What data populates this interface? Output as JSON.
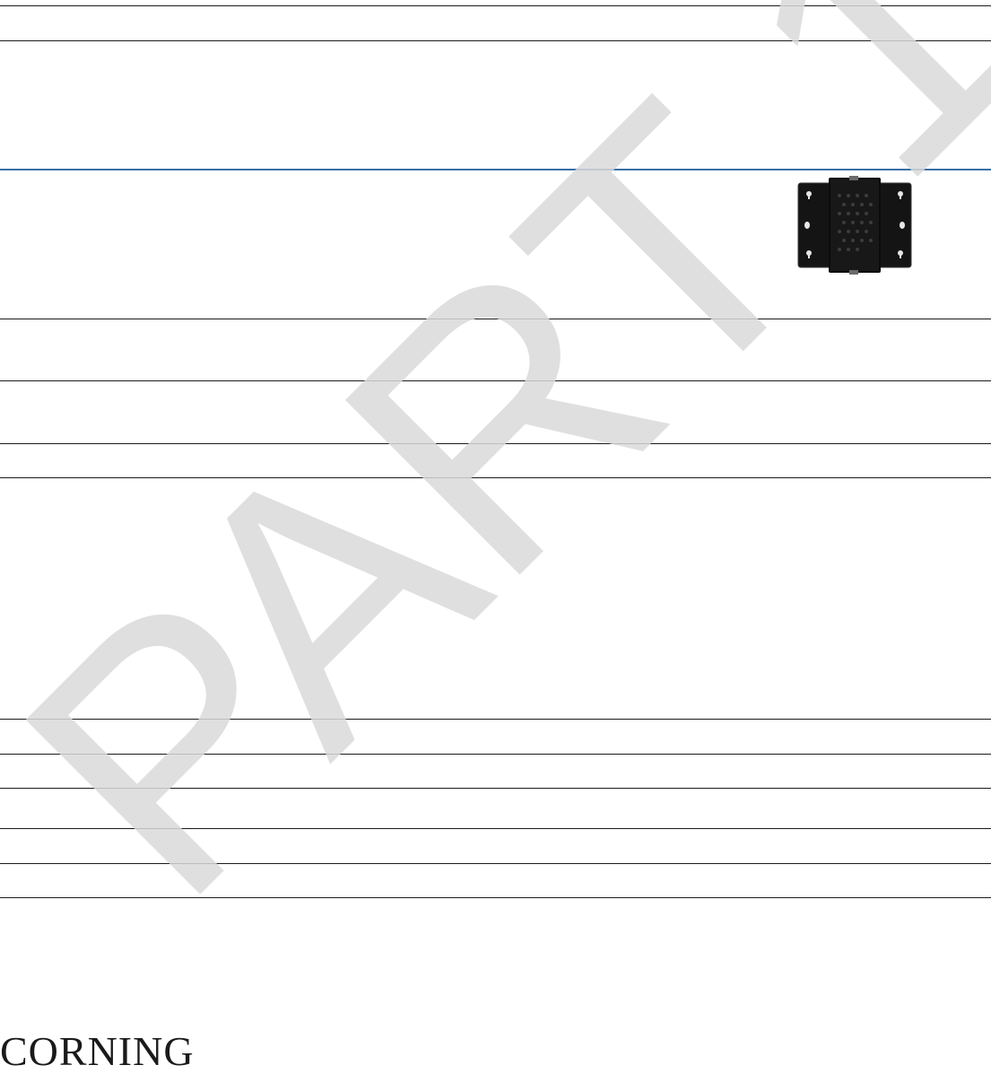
{
  "watermark": {
    "text": "PART 1",
    "color": "#d9d9d9"
  },
  "product_image": {
    "description": "black-mounting-bracket",
    "color": "#111111"
  },
  "footer": {
    "brand": "CORNING"
  },
  "colors": {
    "rule": "#1a1a1a",
    "accent_rule": "#3a6fa6"
  }
}
